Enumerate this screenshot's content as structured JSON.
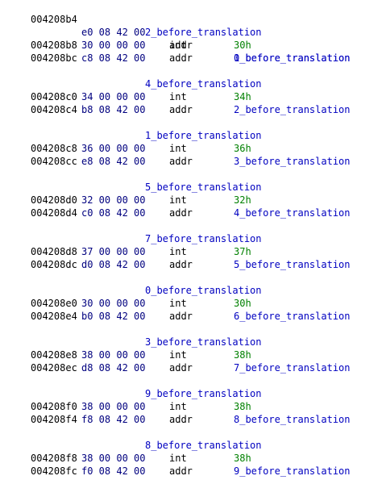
{
  "colors": {
    "address": "#000000",
    "bytes": "#00007f",
    "label": "#0000c0",
    "mnemonic": "#000000",
    "number_operand": "#008000",
    "reference_operand": "#0000c0",
    "background": "#ffffff"
  },
  "listing": {
    "first": {
      "address": "004208b4",
      "bytes": "e0 08 42 00",
      "mnemonic": "addr",
      "operand": "0_before_translation"
    },
    "blocks": [
      {
        "label": "2_before_translation",
        "int_row": {
          "address": "004208b8",
          "bytes": "30 00 00 00",
          "mnemonic": "int",
          "operand": "30h"
        },
        "addr_row": {
          "address": "004208bc",
          "bytes": "c8 08 42 00",
          "mnemonic": "addr",
          "operand": "1_before_translation"
        }
      },
      {
        "label": "4_before_translation",
        "int_row": {
          "address": "004208c0",
          "bytes": "34 00 00 00",
          "mnemonic": "int",
          "operand": "34h"
        },
        "addr_row": {
          "address": "004208c4",
          "bytes": "b8 08 42 00",
          "mnemonic": "addr",
          "operand": "2_before_translation"
        }
      },
      {
        "label": "1_before_translation",
        "int_row": {
          "address": "004208c8",
          "bytes": "36 00 00 00",
          "mnemonic": "int",
          "operand": "36h"
        },
        "addr_row": {
          "address": "004208cc",
          "bytes": "e8 08 42 00",
          "mnemonic": "addr",
          "operand": "3_before_translation"
        }
      },
      {
        "label": "5_before_translation",
        "int_row": {
          "address": "004208d0",
          "bytes": "32 00 00 00",
          "mnemonic": "int",
          "operand": "32h"
        },
        "addr_row": {
          "address": "004208d4",
          "bytes": "c0 08 42 00",
          "mnemonic": "addr",
          "operand": "4_before_translation"
        }
      },
      {
        "label": "7_before_translation",
        "int_row": {
          "address": "004208d8",
          "bytes": "37 00 00 00",
          "mnemonic": "int",
          "operand": "37h"
        },
        "addr_row": {
          "address": "004208dc",
          "bytes": "d0 08 42 00",
          "mnemonic": "addr",
          "operand": "5_before_translation"
        }
      },
      {
        "label": "0_before_translation",
        "int_row": {
          "address": "004208e0",
          "bytes": "30 00 00 00",
          "mnemonic": "int",
          "operand": "30h"
        },
        "addr_row": {
          "address": "004208e4",
          "bytes": "b0 08 42 00",
          "mnemonic": "addr",
          "operand": "6_before_translation"
        }
      },
      {
        "label": "3_before_translation",
        "int_row": {
          "address": "004208e8",
          "bytes": "38 00 00 00",
          "mnemonic": "int",
          "operand": "38h"
        },
        "addr_row": {
          "address": "004208ec",
          "bytes": "d8 08 42 00",
          "mnemonic": "addr",
          "operand": "7_before_translation"
        }
      },
      {
        "label": "9_before_translation",
        "int_row": {
          "address": "004208f0",
          "bytes": "38 00 00 00",
          "mnemonic": "int",
          "operand": "38h"
        },
        "addr_row": {
          "address": "004208f4",
          "bytes": "f8 08 42 00",
          "mnemonic": "addr",
          "operand": "8_before_translation"
        }
      },
      {
        "label": "8_before_translation",
        "int_row": {
          "address": "004208f8",
          "bytes": "38 00 00 00",
          "mnemonic": "int",
          "operand": "38h"
        },
        "addr_row": {
          "address": "004208fc",
          "bytes": "f0 08 42 00",
          "mnemonic": "addr",
          "operand": "9_before_translation"
        }
      }
    ]
  }
}
